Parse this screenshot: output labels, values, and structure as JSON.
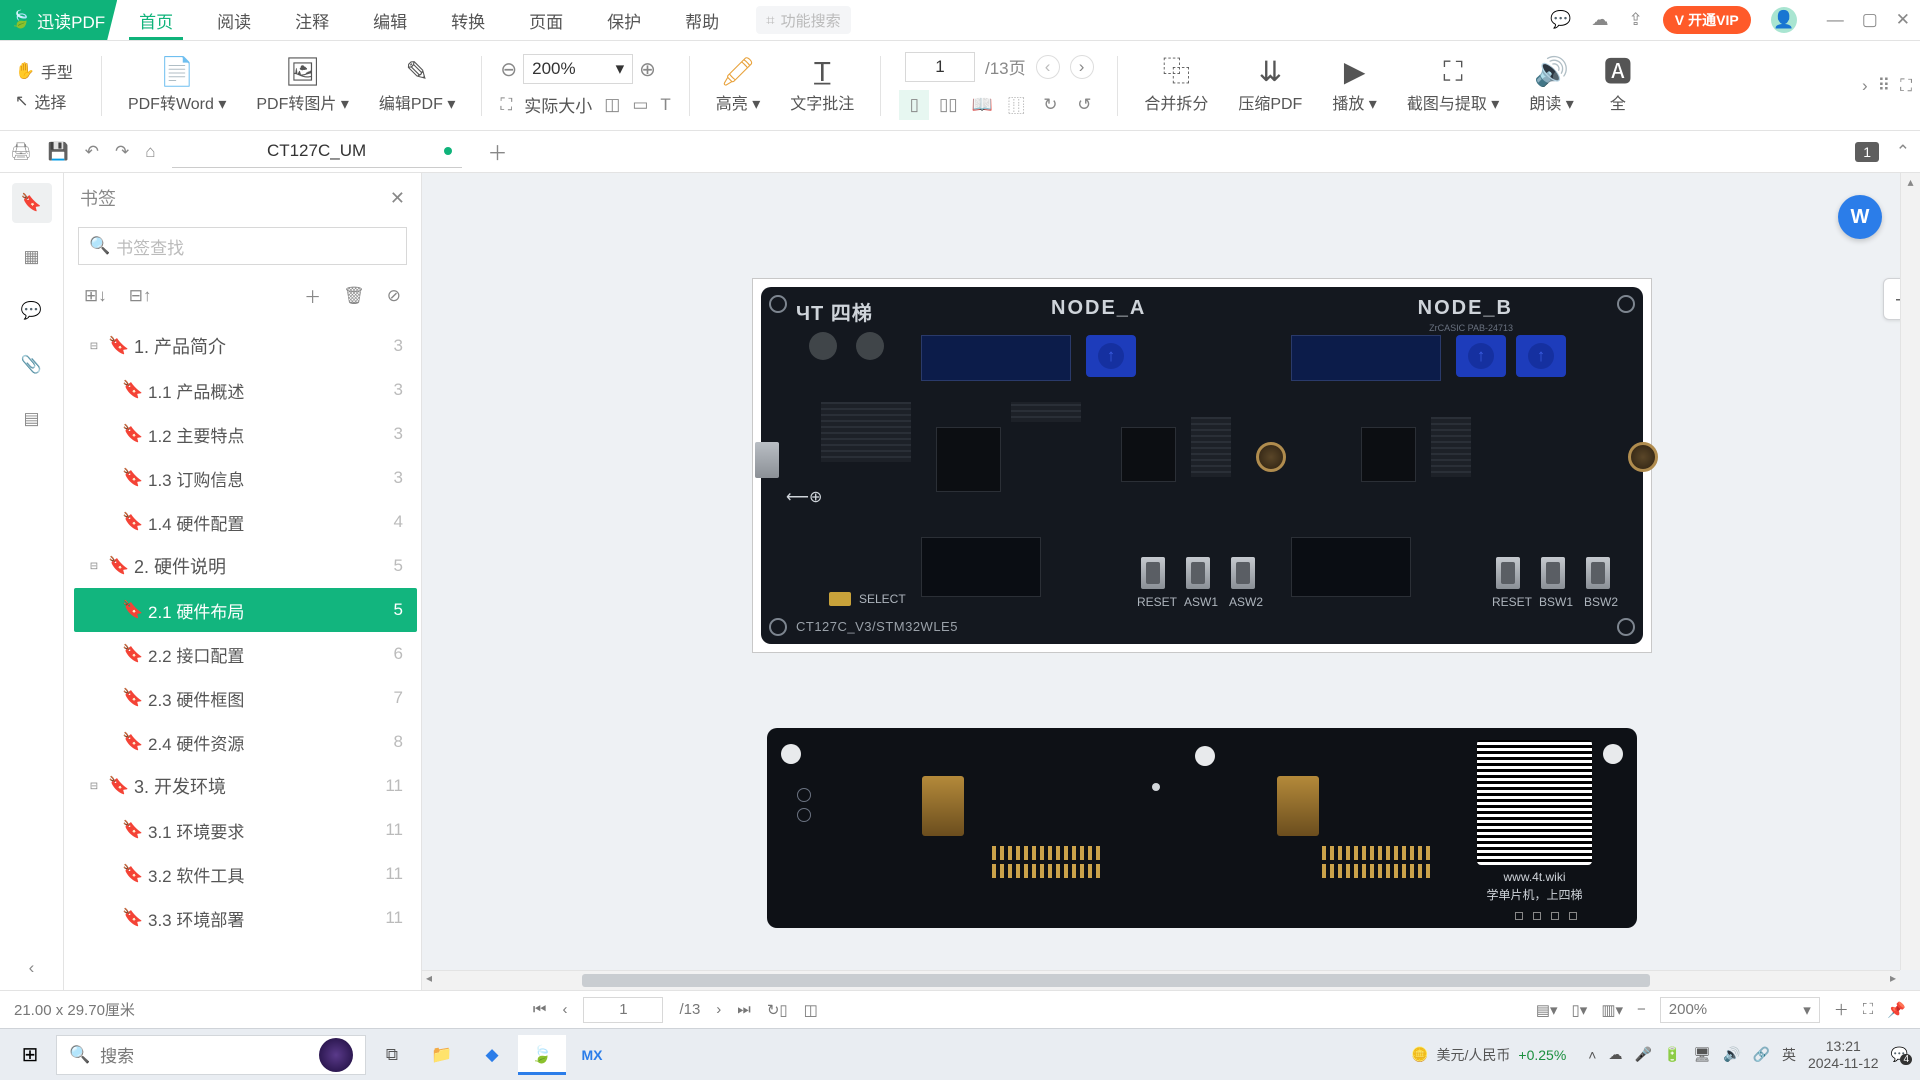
{
  "app": {
    "name": "迅读PDF"
  },
  "menu": [
    "首页",
    "阅读",
    "注释",
    "编辑",
    "转换",
    "页面",
    "保护",
    "帮助"
  ],
  "menu_active": 0,
  "func_search_placeholder": "功能搜索",
  "vip_label": "开通VIP",
  "ribbon": {
    "hand": "手型",
    "select": "选择",
    "pdf2word": "PDF转Word",
    "pdf2img": "PDF转图片",
    "editpdf": "编辑PDF",
    "actual_size": "实际大小",
    "zoom_value": "200%",
    "page_value": "1",
    "page_total": "/13页",
    "highlight": "高亮",
    "text_annot": "文字批注",
    "merge_split": "合并拆分",
    "compress": "压缩PDF",
    "play": "播放",
    "screenshot": "截图与提取",
    "read": "朗读",
    "translate": "全"
  },
  "doc_tab": {
    "name": "CT127C_UM"
  },
  "tab_counter": "1",
  "bookmarks": {
    "title": "书签",
    "search_placeholder": "书签查找",
    "items": [
      {
        "level": 1,
        "label": "1. 产品简介",
        "page": "3",
        "open": true
      },
      {
        "level": 2,
        "label": "1.1 产品概述",
        "page": "3"
      },
      {
        "level": 2,
        "label": "1.2 主要特点",
        "page": "3"
      },
      {
        "level": 2,
        "label": "1.3 订购信息",
        "page": "3"
      },
      {
        "level": 2,
        "label": "1.4 硬件配置",
        "page": "4"
      },
      {
        "level": 1,
        "label": "2. 硬件说明",
        "page": "5",
        "open": true
      },
      {
        "level": 2,
        "label": "2.1 硬件布局",
        "page": "5",
        "active": true
      },
      {
        "level": 2,
        "label": "2.2 接口配置",
        "page": "6"
      },
      {
        "level": 2,
        "label": "2.3 硬件框图",
        "page": "7"
      },
      {
        "level": 2,
        "label": "2.4 硬件资源",
        "page": "8"
      },
      {
        "level": 1,
        "label": "3. 开发环境",
        "page": "11",
        "open": true
      },
      {
        "level": 2,
        "label": "3.1 环境要求",
        "page": "11"
      },
      {
        "level": 2,
        "label": "3.2 软件工具",
        "page": "11"
      },
      {
        "level": 2,
        "label": "3.3 环境部署",
        "page": "11"
      }
    ]
  },
  "board": {
    "logo": "ЧT 四梯",
    "node_a": "NODE_A",
    "node_b": "NODE_B",
    "model": "CT127C_V3/STM32WLE5",
    "btn_labels_a": [
      "RESET",
      "ASW1",
      "ASW2"
    ],
    "btn_labels_b": [
      "RESET",
      "BSW1",
      "BSW2"
    ],
    "select": "SELECT",
    "pcb_small": "ZrCASIC PAB-24713"
  },
  "qr": {
    "url": "www.4t.wiki",
    "slogan": "学单片机，上四梯"
  },
  "dimensions": "21.00 x 29.70厘米",
  "status": {
    "page_value": "1",
    "page_total": "/13",
    "zoom_value": "200%"
  },
  "taskbar": {
    "search_placeholder": "搜索",
    "forex_pair": "美元/人民币",
    "forex_change": "+0.25%",
    "ime": "英",
    "time": "13:21",
    "date": "2024-11-12",
    "notif_count": "4"
  }
}
